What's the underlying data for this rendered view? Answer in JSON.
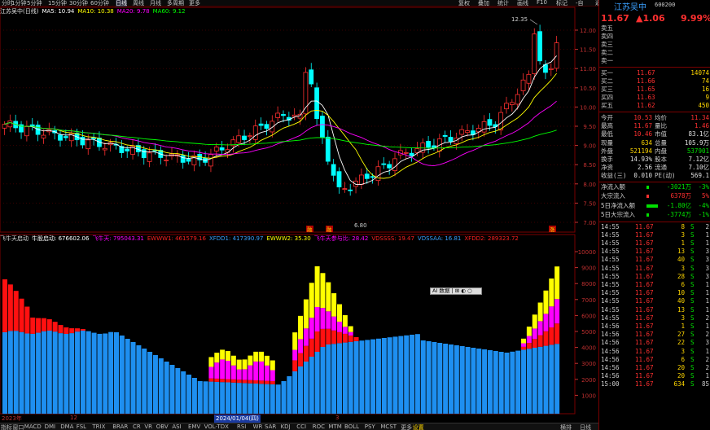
{
  "topbar": {
    "tabs": [
      "分时",
      "1分钟",
      "5分钟",
      "15分钟",
      "30分钟",
      "60分钟",
      "日线",
      "周线",
      "月线",
      "多周期",
      "更多"
    ],
    "active_tab": "日线",
    "right_buttons": [
      "复权",
      "叠加",
      "统计",
      "画线",
      "F10",
      "标记",
      "-自",
      "返回"
    ]
  },
  "main_info": {
    "stock": "江苏吴中(日线)",
    "ma5": "MA5: 10.94",
    "ma10": "MA10: 10.38",
    "ma20": "MA20: 9.78",
    "ma60": "MA60: 9.12",
    "colors": {
      "ma5": "#ffffff",
      "ma10": "#ffff00",
      "ma20": "#ff00ff",
      "ma60": "#00ff00"
    }
  },
  "sub_info": {
    "name": "飞牛天启动",
    "items": [
      {
        "text": "牛股启动: 676602.06",
        "color": "#ffffff"
      },
      {
        "text": "飞牛天: 795043.31",
        "color": "#ff00ff"
      },
      {
        "text": "EWWW1: 461579.16",
        "color": "#ff2020"
      },
      {
        "text": "XFDD1: 417390.97",
        "color": "#3aa0ff"
      },
      {
        "text": "EWWW2: 35.30",
        "color": "#ffff00"
      },
      {
        "text": "飞牛天参与比: 28.42",
        "color": "#ff00ff"
      },
      {
        "text": "VDSSSS: 19.47",
        "color": "#ff2020"
      },
      {
        "text": "VDSSAA: 16.81",
        "color": "#3aa0ff"
      },
      {
        "text": "XFDD2: 289323.72",
        "color": "#ff2020"
      }
    ]
  },
  "price_axis": [
    "12.00",
    "11.50",
    "11.00",
    "10.50",
    "10.00",
    "9.50",
    "9.00",
    "8.50",
    "8.00",
    "7.50",
    "7.00"
  ],
  "vol_axis": [
    "10000",
    "9000",
    "8000",
    "7000",
    "6000",
    "5000",
    "4000",
    "3000",
    "2000",
    "1000"
  ],
  "annotations": {
    "high": "12.35",
    "low": "6.80"
  },
  "markers": [
    "融",
    "融",
    "涨"
  ],
  "time_axis": {
    "labels": [
      "2023年",
      "12",
      "2024/01/04(四)",
      "3"
    ],
    "highlight": "2024/01/04(四)"
  },
  "float_button": "AI  数据  |  ⊞  ◐  ○",
  "bottom_tabs": [
    "指标",
    "窗口",
    "MACD",
    "DMI",
    "DMA",
    "FSL",
    "TRIX",
    "BRAR",
    "CR",
    "VR",
    "OBV",
    "ASI",
    "EMV",
    "VOL-TDX",
    "RSI",
    "WR",
    "SAR",
    "KDJ",
    "CCI",
    "ROC",
    "MTM",
    "BOLL",
    "PSY",
    "MCST",
    "更多",
    "设置"
  ],
  "bottom_right": [
    "横排",
    "日线"
  ],
  "quote": {
    "name": "江苏吴中",
    "code": "600200",
    "price": "11.67",
    "change": "▲1.06",
    "pct": "9.99%",
    "sell": [
      {
        "label": "卖五",
        "price": "",
        "vol": ""
      },
      {
        "label": "卖四",
        "price": "",
        "vol": ""
      },
      {
        "label": "卖三",
        "price": "",
        "vol": ""
      },
      {
        "label": "卖二",
        "price": "",
        "vol": ""
      },
      {
        "label": "卖一",
        "price": "",
        "vol": ""
      }
    ],
    "buy": [
      {
        "label": "买一",
        "price": "11.67",
        "vol": "14074"
      },
      {
        "label": "买二",
        "price": "11.66",
        "vol": "74"
      },
      {
        "label": "买三",
        "price": "11.65",
        "vol": "16"
      },
      {
        "label": "买四",
        "price": "11.63",
        "vol": "9"
      },
      {
        "label": "买五",
        "price": "11.62",
        "vol": "450"
      }
    ],
    "stats": [
      {
        "l1": "今开",
        "v1": "10.53",
        "l2": "均价",
        "v2": "11.34"
      },
      {
        "l1": "最高",
        "v1": "11.67",
        "l2": "量比",
        "v2": "1.46"
      },
      {
        "l1": "最低",
        "v1": "10.46",
        "l2": "市值",
        "v2": "83.1亿"
      },
      {
        "l1": "现量",
        "v1": "634",
        "l2": "总量",
        "v2": "105.9万"
      },
      {
        "l1": "外盘",
        "v1": "521194",
        "l2": "内盘",
        "v2": "537901"
      },
      {
        "l1": "换手",
        "v1": "14.93%",
        "l2": "股本",
        "v2": "7.12亿"
      },
      {
        "l1": "净资",
        "v1": "2.56",
        "l2": "流通",
        "v2": "7.10亿"
      },
      {
        "l1": "收益(三)",
        "v1": "0.010",
        "l2": "PE(动)",
        "v2": "569.1"
      }
    ],
    "flows": [
      {
        "label": "净流入额",
        "value": "-3021万",
        "pct": "-3%",
        "color": "#00e000"
      },
      {
        "label": "大宗流入",
        "value": "6378万",
        "pct": "5%",
        "color": "#ff3030"
      },
      {
        "label": "5日净流入额",
        "value": "-1.80亿",
        "pct": "-4%",
        "color": "#00e000"
      },
      {
        "label": "5日大宗流入",
        "value": "-3774万",
        "pct": "-1%",
        "color": "#00e000"
      }
    ],
    "ticks": [
      {
        "t": "14:55",
        "p": "11.67",
        "v": "8",
        "s": "S",
        "n": "2"
      },
      {
        "t": "14:55",
        "p": "11.67",
        "v": "3",
        "s": "S",
        "n": "1"
      },
      {
        "t": "14:55",
        "p": "11.67",
        "v": "1",
        "s": "S",
        "n": "1"
      },
      {
        "t": "14:55",
        "p": "11.67",
        "v": "13",
        "s": "S",
        "n": "3"
      },
      {
        "t": "14:55",
        "p": "11.67",
        "v": "40",
        "s": "S",
        "n": "3"
      },
      {
        "t": "14:55",
        "p": "11.67",
        "v": "3",
        "s": "S",
        "n": "3"
      },
      {
        "t": "14:55",
        "p": "11.67",
        "v": "28",
        "s": "S",
        "n": "3"
      },
      {
        "t": "14:55",
        "p": "11.67",
        "v": "6",
        "s": "S",
        "n": "1"
      },
      {
        "t": "14:55",
        "p": "11.67",
        "v": "10",
        "s": "S",
        "n": "1"
      },
      {
        "t": "14:55",
        "p": "11.67",
        "v": "40",
        "s": "S",
        "n": "1"
      },
      {
        "t": "14:55",
        "p": "11.67",
        "v": "13",
        "s": "S",
        "n": "1"
      },
      {
        "t": "14:55",
        "p": "11.67",
        "v": "3",
        "s": "S",
        "n": "2"
      },
      {
        "t": "14:56",
        "p": "11.67",
        "v": "1",
        "s": "S",
        "n": "1"
      },
      {
        "t": "14:56",
        "p": "11.67",
        "v": "27",
        "s": "S",
        "n": "2"
      },
      {
        "t": "14:56",
        "p": "11.67",
        "v": "22",
        "s": "S",
        "n": "3"
      },
      {
        "t": "14:56",
        "p": "11.67",
        "v": "3",
        "s": "S",
        "n": "1"
      },
      {
        "t": "14:56",
        "p": "11.67",
        "v": "6",
        "s": "S",
        "n": "2"
      },
      {
        "t": "14:56",
        "p": "11.67",
        "v": "20",
        "s": "S",
        "n": "2"
      },
      {
        "t": "14:56",
        "p": "11.67",
        "v": "20",
        "s": "S",
        "n": "1"
      },
      {
        "t": "15:00",
        "p": "11.67",
        "v": "634",
        "s": "S",
        "n": "85"
      }
    ]
  }
}
